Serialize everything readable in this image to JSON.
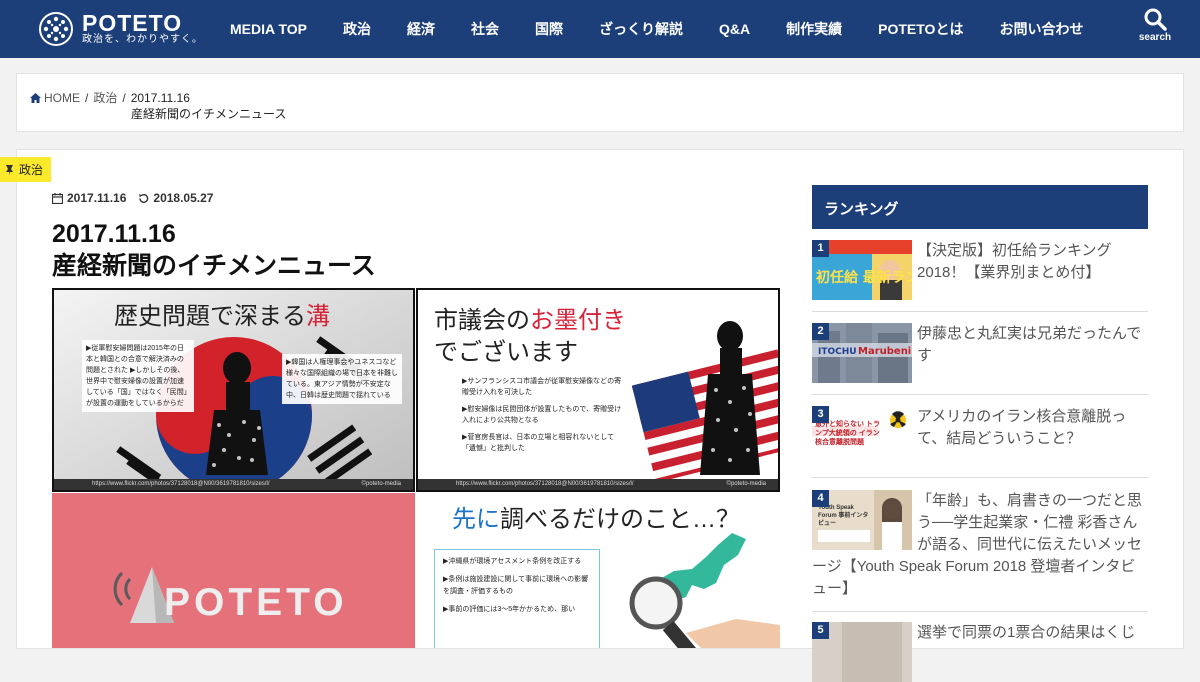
{
  "header": {
    "logo_name": "POTETO",
    "logo_tagline": "政治を、わかりやすく。",
    "nav": [
      "MEDIA TOP",
      "政治",
      "経済",
      "社会",
      "国際",
      "ざっくり解説",
      "Q&A",
      "制作実績",
      "POTETOとは",
      "お問い合わせ"
    ],
    "search_label": "search"
  },
  "breadcrumb": {
    "home": "HOME",
    "category": "政治",
    "date": "2017.11.16",
    "title": "産経新聞のイチメンニュース"
  },
  "article": {
    "category_badge": "政治",
    "posted": "2017.11.16",
    "updated": "2018.05.27",
    "title_line1": "2017.11.16",
    "title_line2": "産経新聞のイチメンニュース",
    "image": {
      "p1_heading_a": "歴史問題で深まる",
      "p1_heading_b": "溝",
      "p1_note_left": "▶従軍慰安婦問題は2015年の日本と韓国との合意で解決済みの問題とされた ▶しかしその後、世界中で慰安婦像の設置が加速している「国」ではなく「民間」が設置の運動をしているからだ",
      "p1_note_right": "▶韓国は人権理事会やユネスコなど様々な国際組織の場で日本を非難している。東アジア情勢が不安定な中、日韓は歴史問題で揺れている",
      "p2_heading_a": "市議会の",
      "p2_heading_b": "お墨付き",
      "p2_heading_c": "でございます",
      "p2_bullet1": "▶サンフランシスコ市議会が従軍慰安婦像などの寄贈受け入れを可決した",
      "p2_bullet2": "▶慰安婦像は民間団体が設置したもので、寄贈受け入れにより公共物となる",
      "p2_bullet3": "▶菅官房長官は、日本の立場と相容れないとして「遺憾」と批判した",
      "strip_url": "https://www.flickr.com/photos/37128018@N00/3619781810/sizes/l/",
      "strip_credit": "©poteto-media",
      "p3_word": "POTETO",
      "p4_heading_a": "先に",
      "p4_heading_b": "調べるだけのこと…？",
      "p4_bullet1": "▶沖縄県が環境アセスメント条例を改正する",
      "p4_bullet2": "▶条例は施設建設に関して事前に環境への影響を調査・評価するもの",
      "p4_bullet3": "▶事前の評価には3〜5年かかるため、那い"
    }
  },
  "sidebar": {
    "ranking_title": "ランキング",
    "items": [
      {
        "rank": "1",
        "title": "【決定版】初任給ランキング2018！【業界別まとめ付】",
        "thumb_text": "初任給 最新ランキング"
      },
      {
        "rank": "2",
        "title": "伊藤忠と丸紅実は兄弟だったんです",
        "thumb_text": "Marubeni"
      },
      {
        "rank": "3",
        "title": "アメリカのイラン核合意離脱って、結局どういうこと？",
        "thumb_text": "意外と知らない トランプ大統領の イラン核合意離脱問題"
      },
      {
        "rank": "4",
        "title": "「年齢」も、肩書きの一つだと思う──学生起業家・仁禮 彩香さんが語る、同世代に伝えたいメッセージ【Youth Speak Forum 2018 登壇者インタビュー】",
        "thumb_text": "Youth Speak Forum 事前インタビュー"
      },
      {
        "rank": "5",
        "title": "選挙で同票の1票合の結果はくじ",
        "thumb_text": ""
      }
    ]
  },
  "colors": {
    "brand_navy": "#1c3f7a",
    "badge_yellow": "#fde92b",
    "accent_red": "#d6243a"
  }
}
